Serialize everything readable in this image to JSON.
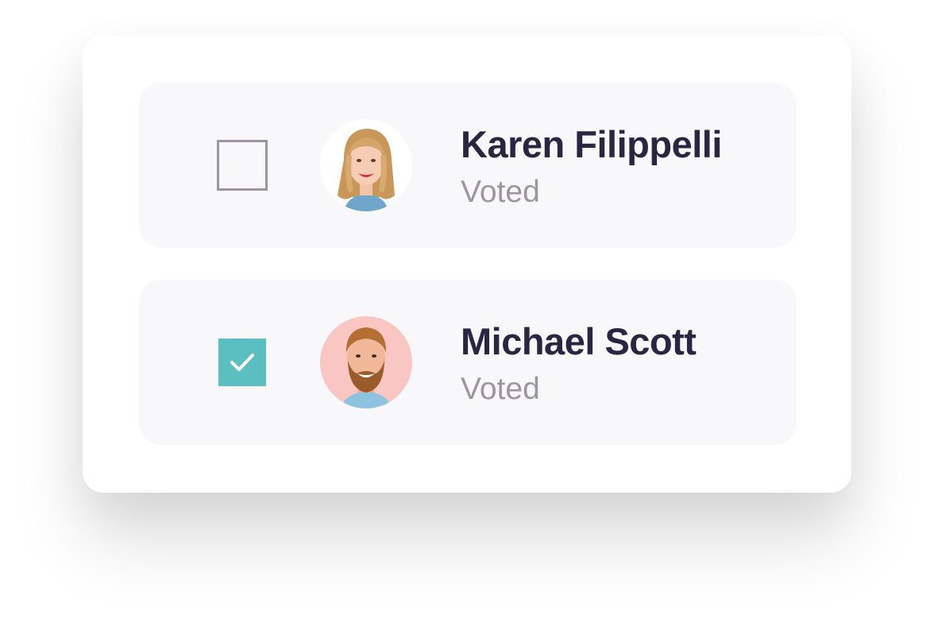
{
  "voters": [
    {
      "name": "Karen Filippelli",
      "status": "Voted",
      "checked": false,
      "avatar_icon": "woman-portrait"
    },
    {
      "name": "Michael Scott",
      "status": "Voted",
      "checked": true,
      "avatar_icon": "man-portrait"
    }
  ],
  "colors": {
    "row_background": "#f8f7fa",
    "checkbox_checked": "#5bbfc1",
    "checkbox_border": "#9b95a6",
    "name_text": "#2a2540",
    "status_text": "#9a96a3"
  }
}
